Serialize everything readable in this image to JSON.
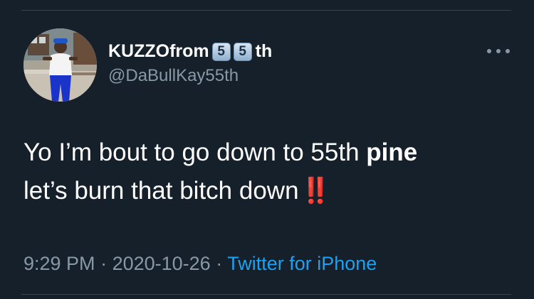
{
  "tweet": {
    "display_name": "KUZZOfrom",
    "name_emoji_digits": [
      "5",
      "5"
    ],
    "name_suffix": "th",
    "handle": "@DaBullKay55th",
    "text_line1_prefix": "Yo I’m bout to go down to 55th ",
    "text_line1_bold": "pine",
    "text_line2": "let’s burn that bitch down",
    "text_emoji": "‼️",
    "time": "9:29 PM",
    "separator": " · ",
    "date": "2020-10-26",
    "source": "Twitter for iPhone",
    "more_icon": "more-horizontal-icon"
  },
  "colors": {
    "background": "#15202b",
    "primary_text": "#ffffff",
    "secondary_text": "#8899a6",
    "link": "#1da1f2",
    "divider": "#38444d"
  }
}
